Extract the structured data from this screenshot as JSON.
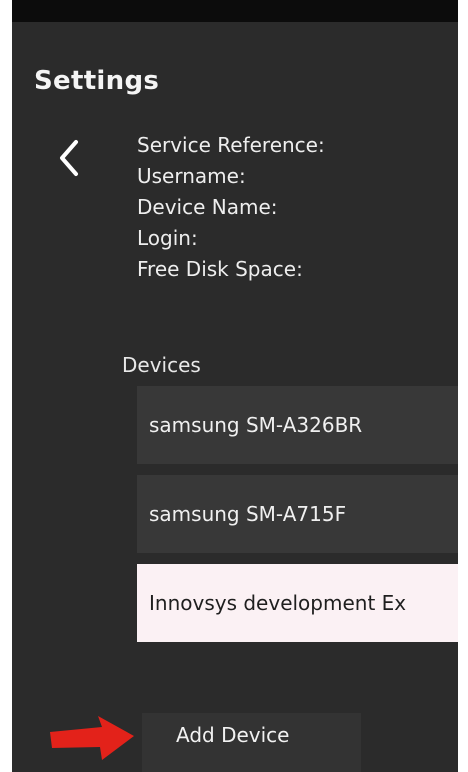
{
  "header": {
    "title": "Settings"
  },
  "icons": {
    "back": "chevron-left-icon",
    "annotation": "red-arrow-icon"
  },
  "account_info": {
    "service_reference_label": "Service Reference:",
    "username_label": "Username:",
    "device_name_label": "Device Name:",
    "login_label": "Login:",
    "free_disk_space_label": "Free Disk Space:"
  },
  "devices": {
    "label": "Devices",
    "items": [
      {
        "name": "samsung SM-A326BR",
        "selected": false
      },
      {
        "name": "samsung SM-A715F",
        "selected": false
      },
      {
        "name": "Innovsys development Ex",
        "selected": true
      }
    ]
  },
  "actions": {
    "add_device_label": "Add Device"
  },
  "colors": {
    "background": "#2b2b2b",
    "item_background": "#383838",
    "selected_item_background": "#fbf1f4",
    "arrow": "#e3221a"
  }
}
